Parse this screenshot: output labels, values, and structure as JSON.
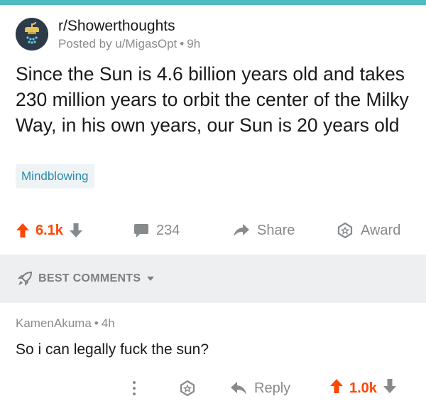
{
  "post": {
    "subreddit": "r/Showerthoughts",
    "posted_by_prefix": "Posted by",
    "author": "u/MigasOpt",
    "separator": "•",
    "age": "9h",
    "title": "Since the Sun is 4.6 billion years old and takes 230 million years to orbit the center of the Milky Way, in his own years, our Sun is 20 years old",
    "flair": "Mindblowing",
    "score": "6.1k",
    "comments_count": "234",
    "share_label": "Share",
    "award_label": "Award"
  },
  "sort": {
    "label": "BEST COMMENTS"
  },
  "comment": {
    "author": "KamenAkuma",
    "separator": "•",
    "age": "4h",
    "body": "So i can legally fuck the sun?",
    "reply_label": "Reply",
    "score": "1.0k"
  },
  "icons": {
    "subreddit_avatar": "showerhead-lightbulb-icon",
    "upvote": "upvote-arrow-icon",
    "downvote": "downvote-arrow-icon",
    "comments": "comment-bubble-icon",
    "share": "share-arrow-icon",
    "award": "award-badge-icon",
    "sort": "rocket-icon",
    "dropdown": "chevron-down-icon",
    "more": "more-vertical-icon",
    "reply": "reply-arrow-icon"
  },
  "colors": {
    "accent_top": "#4fbcc3",
    "upvote": "#ff4500",
    "flair_text": "#2a8aa8",
    "muted": "#878a8c"
  }
}
